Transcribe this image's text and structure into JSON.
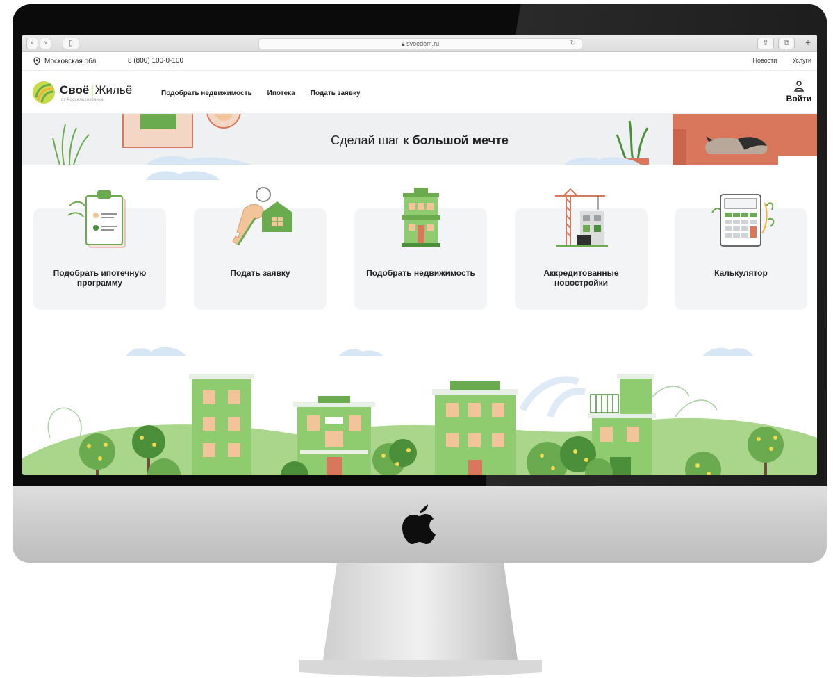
{
  "browser": {
    "url": "svoedom.ru"
  },
  "topbar": {
    "region": "Московская обл.",
    "phone": "8 (800) 100-0-100",
    "links": [
      "Новости",
      "Услуги"
    ]
  },
  "header": {
    "brand_left": "Своё",
    "brand_right": "Жильё",
    "brand_sub": "от Россельхозбанка",
    "nav": [
      "Подобрать недвижимость",
      "Ипотека",
      "Подать заявку"
    ],
    "login_label": "Войти"
  },
  "hero": {
    "title_plain": "Сделай шаг к",
    "title_bold": "большой мечте"
  },
  "cards": [
    {
      "label": "Подобрать ипотечную программу",
      "icon": "clipboard-icon"
    },
    {
      "label": "Подать заявку",
      "icon": "key-house-icon"
    },
    {
      "label": "Подобрать недвижимость",
      "icon": "building-icon"
    },
    {
      "label": "Аккредитованные новостройки",
      "icon": "crane-icon"
    },
    {
      "label": "Калькулятор",
      "icon": "calculator-icon"
    }
  ],
  "colors": {
    "green": "#6aab4f",
    "light_green": "#8fcb6f",
    "card_bg": "#f3f4f6",
    "hero_bg": "#eef0f2"
  }
}
